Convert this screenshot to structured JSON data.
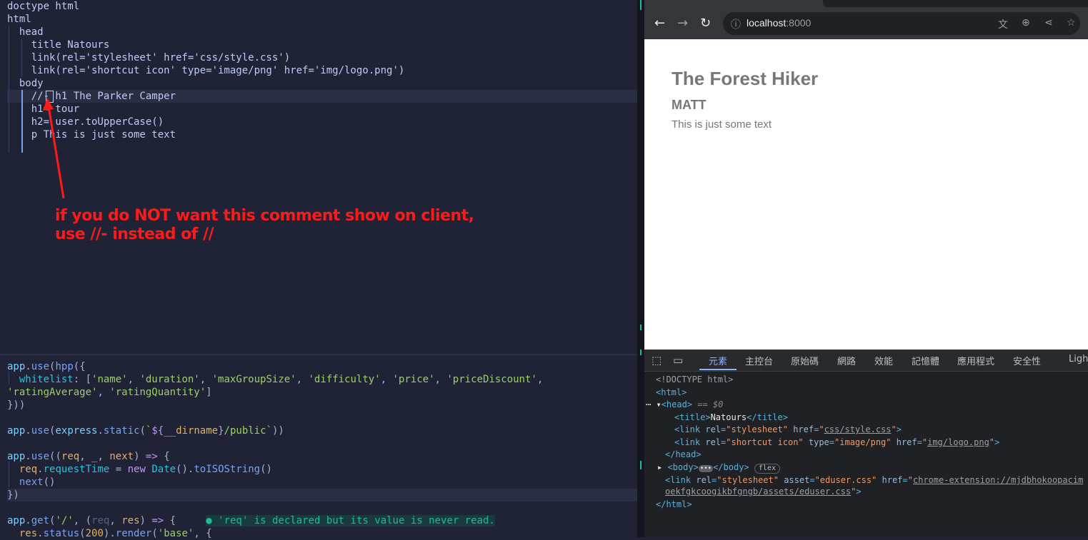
{
  "editor": {
    "top_lines": [
      "doctype html",
      "html",
      "  head",
      "    title Natours",
      "    link(rel='stylesheet' href='css/style.css')",
      "    link(rel='shortcut icon' type='image/png' href='img/logo.png')",
      "  body",
      "    //- h1 The Parker Camper",
      "    h1= tour",
      "    h2= user.toUpperCase()",
      "    p This is just some text"
    ],
    "annotation_line1": "if you do NOT want this comment show on client,",
    "annotation_line2": "use //- instead of //",
    "diagnostic": "● 'req' is declared but its value is never read."
  },
  "browser": {
    "url_host": "localhost",
    "url_port": ":8000",
    "page": {
      "h1": "The Forest Hiker",
      "h2": "MATT",
      "p": "This is just some text"
    }
  },
  "devtools": {
    "tabs": [
      "元素",
      "主控台",
      "原始碼",
      "網路",
      "效能",
      "記憶體",
      "應用程式",
      "安全性",
      "Ligh"
    ],
    "active_tab": "元素",
    "dom_lines": [
      "<!DOCTYPE html>",
      "<html>",
      "<head> == $0",
      "<title>Natours</title>",
      "<link rel=\"stylesheet\" href=\"css/style.css\">",
      "<link rel=\"shortcut icon\" type=\"image/png\" href=\"img/logo.png\">",
      "</head>",
      "<body>",
      "</body>",
      "flex",
      "<link rel=\"stylesheet\" asset=\"eduser.css\" href=\"chrome-extension://mjdbhokoopacim",
      "oekfgkcoogikbfgngb/assets/eduser.css\">",
      "</html>"
    ]
  }
}
